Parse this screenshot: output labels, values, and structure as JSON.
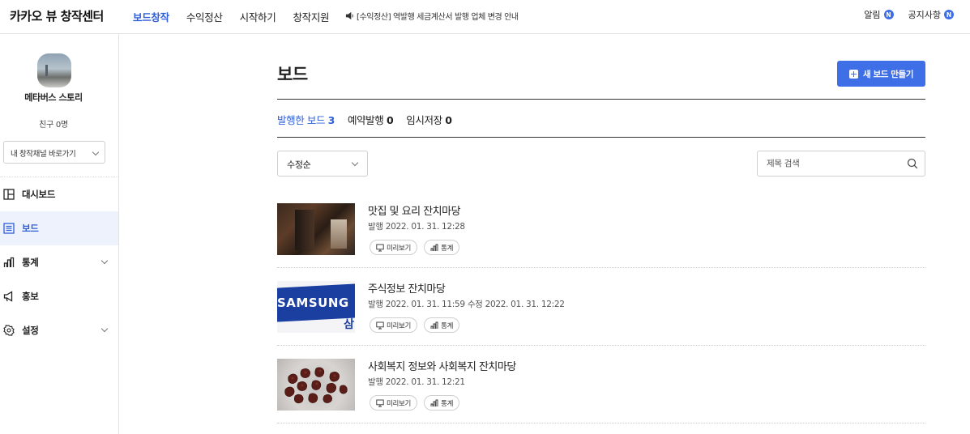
{
  "header": {
    "brand": "카카오 뷰 창작센터",
    "nav": [
      "보드창작",
      "수익정산",
      "시작하기",
      "창작지원"
    ],
    "notice": "[수익정산] 역발행 세금계산서 발행 업체 변경 안내",
    "alarm_label": "알림",
    "notice_label": "공지사항",
    "new_badge": "N"
  },
  "sidebar": {
    "channel_name": "메타버스 스토리",
    "friends": "친구 0명",
    "channel_select": "내 창작채널 바로가기",
    "menu": [
      "대시보드",
      "보드",
      "통계",
      "홍보",
      "설정"
    ]
  },
  "main": {
    "title": "보드",
    "new_board_button": "새 보드 만들기",
    "tabs": [
      {
        "label": "발행한 보드",
        "count": "3"
      },
      {
        "label": "예약발행",
        "count": "0"
      },
      {
        "label": "임시저장",
        "count": "0"
      }
    ],
    "sort": "수정순",
    "search_placeholder": "제목 검색",
    "preview_label": "미리보기",
    "stats_label": "통계",
    "boards": [
      {
        "title": "맛집 및 요리 잔치마당",
        "meta": "발행 2022. 01. 31. 12:28"
      },
      {
        "title": "주식정보 잔치마당",
        "meta": "발행 2022. 01. 31. 11:59 수정 2022. 01. 31. 12:22"
      },
      {
        "title": "사회복지 정보와 사회복지 잔치마당",
        "meta": "발행 2022. 01. 31. 12:21"
      }
    ],
    "thumb_text": {
      "logo": "SAMSUNG",
      "korean": "삼"
    }
  },
  "colors": {
    "accent": "#3f6fe6",
    "active_text": "#2f5fd8"
  }
}
